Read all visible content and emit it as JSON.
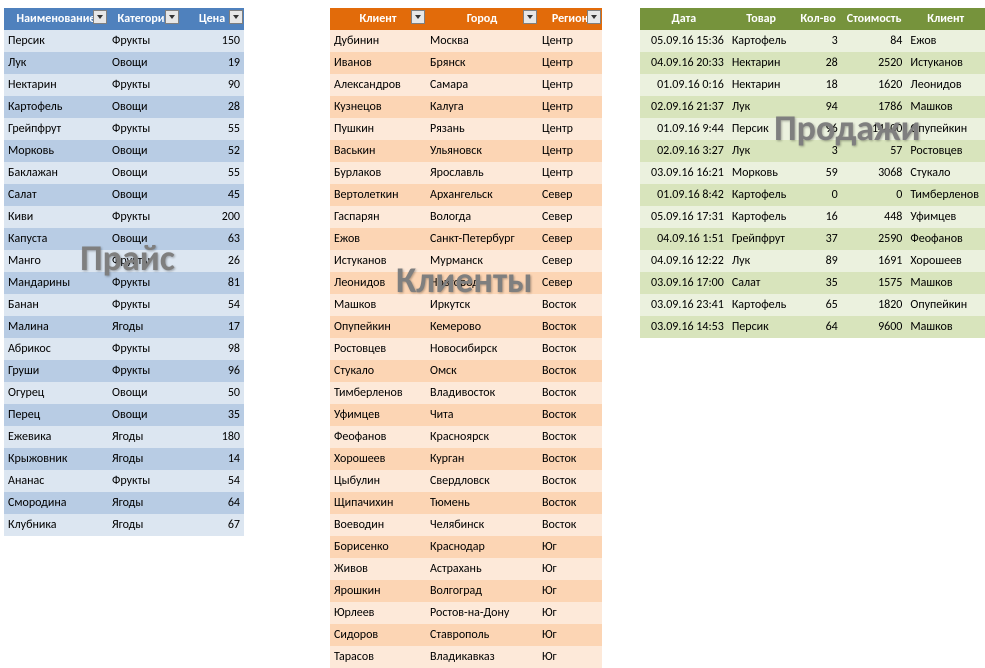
{
  "watermarks": {
    "blue": "Прайс",
    "orange": "Клиенты",
    "green": "Продажи"
  },
  "blue": {
    "headers": [
      "Наименование",
      "Категория",
      "Цена"
    ],
    "rows": [
      [
        "Персик",
        "Фрукты",
        "150"
      ],
      [
        "Лук",
        "Овощи",
        "19"
      ],
      [
        "Нектарин",
        "Фрукты",
        "90"
      ],
      [
        "Картофель",
        "Овощи",
        "28"
      ],
      [
        "Грейпфрут",
        "Фрукты",
        "55"
      ],
      [
        "Морковь",
        "Овощи",
        "52"
      ],
      [
        "Баклажан",
        "Овощи",
        "55"
      ],
      [
        "Салат",
        "Овощи",
        "45"
      ],
      [
        "Киви",
        "Фрукты",
        "200"
      ],
      [
        "Капуста",
        "Овощи",
        "63"
      ],
      [
        "Манго",
        "Фрукты",
        "26"
      ],
      [
        "Мандарины",
        "Фрукты",
        "81"
      ],
      [
        "Банан",
        "Фрукты",
        "54"
      ],
      [
        "Малина",
        "Ягоды",
        "17"
      ],
      [
        "Абрикос",
        "Фрукты",
        "98"
      ],
      [
        "Груши",
        "Фрукты",
        "96"
      ],
      [
        "Огурец",
        "Овощи",
        "50"
      ],
      [
        "Перец",
        "Овощи",
        "35"
      ],
      [
        "Ежевика",
        "Ягоды",
        "180"
      ],
      [
        "Крыжовник",
        "Ягоды",
        "14"
      ],
      [
        "Ананас",
        "Фрукты",
        "54"
      ],
      [
        "Смородина",
        "Ягоды",
        "64"
      ],
      [
        "Клубника",
        "Ягоды",
        "67"
      ]
    ]
  },
  "orange": {
    "headers": [
      "Клиент",
      "Город",
      "Регион"
    ],
    "rows": [
      [
        "Дубинин",
        "Москва",
        "Центр"
      ],
      [
        "Иванов",
        "Брянск",
        "Центр"
      ],
      [
        "Александров",
        "Самара",
        "Центр"
      ],
      [
        "Кузнецов",
        "Калуга",
        "Центр"
      ],
      [
        "Пушкин",
        "Рязань",
        "Центр"
      ],
      [
        "Васькин",
        "Ульяновск",
        "Центр"
      ],
      [
        "Бурлаков",
        "Ярославль",
        "Центр"
      ],
      [
        "Вертолеткин",
        "Архангельск",
        "Север"
      ],
      [
        "Гаспарян",
        "Вологда",
        "Север"
      ],
      [
        "Ежов",
        "Санкт-Петербург",
        "Север"
      ],
      [
        "Истуканов",
        "Мурманск",
        "Север"
      ],
      [
        "Леонидов",
        "Новгород",
        "Север"
      ],
      [
        "Машков",
        "Иркутск",
        "Восток"
      ],
      [
        "Опупейкин",
        "Кемерово",
        "Восток"
      ],
      [
        "Ростовцев",
        "Новосибирск",
        "Восток"
      ],
      [
        "Стукало",
        "Омск",
        "Восток"
      ],
      [
        "Тимберленов",
        "Владивосток",
        "Восток"
      ],
      [
        "Уфимцев",
        "Чита",
        "Восток"
      ],
      [
        "Феофанов",
        "Красноярск",
        "Восток"
      ],
      [
        "Хорошеев",
        "Курган",
        "Восток"
      ],
      [
        "Цыбулин",
        "Свердловск",
        "Восток"
      ],
      [
        "Щипачихин",
        "Тюмень",
        "Восток"
      ],
      [
        "Воеводин",
        "Челябинск",
        "Восток"
      ],
      [
        "Борисенко",
        "Краснодар",
        "Юг"
      ],
      [
        "Живов",
        "Астрахань",
        "Юг"
      ],
      [
        "Ярошкин",
        "Волгоград",
        "Юг"
      ],
      [
        "Юрлеев",
        "Ростов-на-Дону",
        "Юг"
      ],
      [
        "Сидоров",
        "Ставрополь",
        "Юг"
      ],
      [
        "Тарасов",
        "Владикавказ",
        "Юг"
      ]
    ]
  },
  "green": {
    "headers": [
      "Дата",
      "Товар",
      "Кол-во",
      "Стоимость",
      "Клиент"
    ],
    "rows": [
      [
        "05.09.16 15:36",
        "Картофель",
        "3",
        "84",
        "Ежов"
      ],
      [
        "04.09.16 20:33",
        "Нектарин",
        "28",
        "2520",
        "Истуканов"
      ],
      [
        "01.09.16 0:16",
        "Нектарин",
        "18",
        "1620",
        "Леонидов"
      ],
      [
        "02.09.16 21:37",
        "Лук",
        "94",
        "1786",
        "Машков"
      ],
      [
        "01.09.16 9:44",
        "Персик",
        "96",
        "14400",
        "Опупейкин"
      ],
      [
        "02.09.16 3:27",
        "Лук",
        "3",
        "57",
        "Ростовцев"
      ],
      [
        "03.09.16 16:21",
        "Морковь",
        "59",
        "3068",
        "Стукало"
      ],
      [
        "01.09.16 8:42",
        "Картофель",
        "0",
        "0",
        "Тимберленов"
      ],
      [
        "05.09.16 17:31",
        "Картофель",
        "16",
        "448",
        "Уфимцев"
      ],
      [
        "04.09.16 1:51",
        "Грейпфрут",
        "37",
        "2590",
        "Феофанов"
      ],
      [
        "04.09.16 12:22",
        "Лук",
        "89",
        "1691",
        "Хорошеев"
      ],
      [
        "03.09.16 17:00",
        "Салат",
        "35",
        "1575",
        "Машков"
      ],
      [
        "03.09.16 23:41",
        "Картофель",
        "65",
        "1820",
        "Опупейкин"
      ],
      [
        "03.09.16 14:53",
        "Персик",
        "64",
        "9600",
        "Машков"
      ]
    ]
  }
}
